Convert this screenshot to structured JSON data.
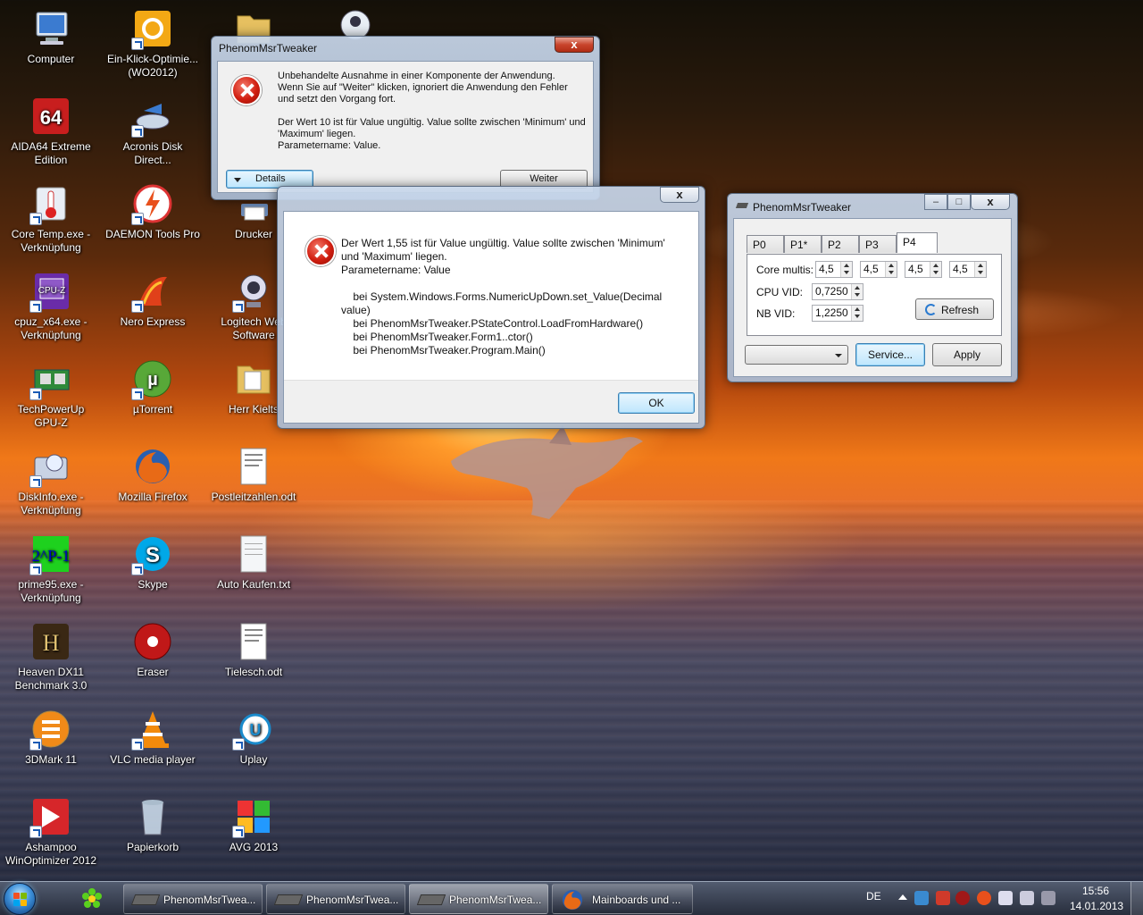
{
  "desktop": {
    "icons": [
      {
        "label": "Computer",
        "icon": "computer-icon"
      },
      {
        "label": "Ein-Klick-Optimie... (WO2012)",
        "icon": "wo2012-icon"
      },
      {
        "label": "",
        "icon": "folder-icon"
      },
      {
        "label": "",
        "icon": "user-icon"
      },
      {
        "label": "AIDA64 Extreme Edition",
        "icon": "aida64-icon"
      },
      {
        "label": "Acronis Disk Direct...",
        "icon": "acronis-icon"
      },
      {
        "label": "Core Temp.exe - Verknüpfung",
        "icon": "thermometer-icon"
      },
      {
        "label": "DAEMON Tools Pro",
        "icon": "daemon-tools-icon"
      },
      {
        "label": "Drucker",
        "icon": "printer-icon"
      },
      {
        "label": "cpuz_x64.exe - Verknüpfung",
        "icon": "cpuz-icon"
      },
      {
        "label": "Nero Express",
        "icon": "nero-icon"
      },
      {
        "label": "Logitech Web Software",
        "icon": "webcam-icon"
      },
      {
        "label": "TechPowerUp GPU-Z",
        "icon": "gpuz-icon"
      },
      {
        "label": "µTorrent",
        "icon": "utorrent-icon"
      },
      {
        "label": "Herr Kielts",
        "icon": "folder-icon"
      },
      {
        "label": "DiskInfo.exe - Verknüpfung",
        "icon": "diskinfo-icon"
      },
      {
        "label": "Mozilla Firefox",
        "icon": "firefox-icon"
      },
      {
        "label": "Postleitzahlen.odt",
        "icon": "document-icon"
      },
      {
        "label": "prime95.exe - Verknüpfung",
        "icon": "prime95-icon"
      },
      {
        "label": "Skype",
        "icon": "skype-icon"
      },
      {
        "label": "Auto Kaufen.txt",
        "icon": "text-file-icon"
      },
      {
        "label": "Heaven DX11 Benchmark 3.0",
        "icon": "heaven-icon"
      },
      {
        "label": "Eraser",
        "icon": "eraser-icon"
      },
      {
        "label": "Tielesch.odt",
        "icon": "document-icon"
      },
      {
        "label": "3DMark 11",
        "icon": "3dmark-icon"
      },
      {
        "label": "VLC media player",
        "icon": "vlc-icon"
      },
      {
        "label": "Uplay",
        "icon": "uplay-icon"
      },
      {
        "label": "Ashampoo WinOptimizer 2012",
        "icon": "ashampoo-icon"
      },
      {
        "label": "Papierkorb",
        "icon": "recycle-bin-icon"
      },
      {
        "label": "AVG 2013",
        "icon": "avg-icon"
      }
    ]
  },
  "dialog1": {
    "title": "PhenomMsrTweaker",
    "close": "x",
    "line1": "Unbehandelte Ausnahme in einer Komponente der Anwendung.",
    "line2": "Wenn Sie auf \"Weiter\" klicken, ignoriert die Anwendung den Fehler",
    "line3": "und setzt den Vorgang fort.",
    "line4": "Der Wert 10 ist für Value ungültig. Value sollte zwischen 'Minimum' und",
    "line5": "'Maximum' liegen.",
    "line6": "Parametername: Value.",
    "details": "Details",
    "weiter": "Weiter"
  },
  "dialog2": {
    "close": "x",
    "text": "Der Wert 1,55 ist für Value ungültig. Value sollte zwischen 'Minimum'\nund 'Maximum' liegen.\nParametername: Value\n\n    bei System.Windows.Forms.NumericUpDown.set_Value(Decimal\nvalue)\n    bei PhenomMsrTweaker.PStateControl.LoadFromHardware()\n    bei PhenomMsrTweaker.Form1..ctor()\n    bei PhenomMsrTweaker.Program.Main()",
    "ok": "OK"
  },
  "tweaker": {
    "title": "PhenomMsrTweaker",
    "minimize": "–",
    "maximize": "□",
    "close": "x",
    "tabs": [
      "P0",
      "P1*",
      "P2",
      "P3",
      "P4"
    ],
    "active_tab": "P4",
    "core_multis_label": "Core multis:",
    "core_multis": [
      "4,5",
      "4,5",
      "4,5",
      "4,5"
    ],
    "cpu_vid_label": "CPU VID:",
    "cpu_vid": "0,7250",
    "nb_vid_label": "NB VID:",
    "nb_vid": "1,2250",
    "refresh": "Refresh",
    "service": "Service...",
    "apply": "Apply",
    "dropdown_value": ""
  },
  "taskbar": {
    "buttons": [
      {
        "label": "PhenomMsrTwea...",
        "icon": "chip-icon"
      },
      {
        "label": "PhenomMsrTwea...",
        "icon": "chip-icon"
      },
      {
        "label": "PhenomMsrTwea...",
        "icon": "chip-icon"
      },
      {
        "label": "Mainboards und ...",
        "icon": "firefox-icon"
      }
    ],
    "language": "DE",
    "time": "15:56",
    "date": "14.01.2013"
  }
}
